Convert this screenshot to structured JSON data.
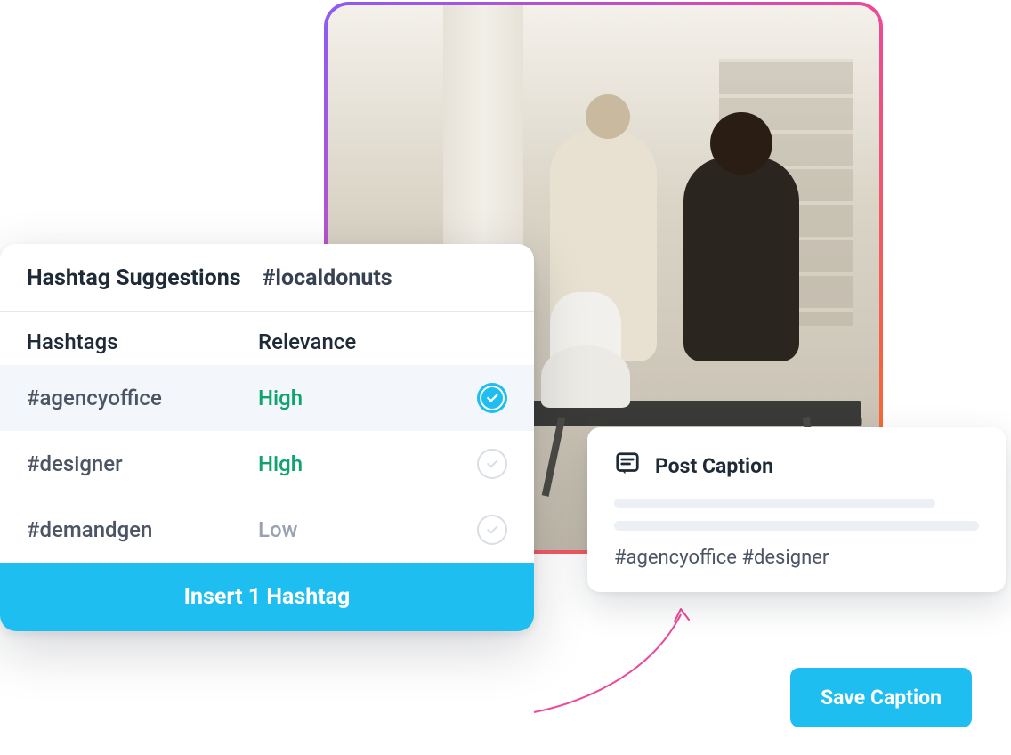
{
  "hashtagPanel": {
    "title": "Hashtag Suggestions",
    "sample": "#localdonuts",
    "columns": {
      "hashtags": "Hashtags",
      "relevance": "Relevance"
    },
    "rows": [
      {
        "tag": "#agencyoffice",
        "relevance": "High",
        "relevanceLevel": "high",
        "selected": true
      },
      {
        "tag": "#designer",
        "relevance": "High",
        "relevanceLevel": "high",
        "selected": false
      },
      {
        "tag": "#demandgen",
        "relevance": "Low",
        "relevanceLevel": "low",
        "selected": false
      }
    ],
    "insertLabel": "Insert 1 Hashtag"
  },
  "captionCard": {
    "title": "Post Caption",
    "captionText": "#agencyoffice #designer"
  },
  "saveButton": {
    "label": "Save Caption"
  },
  "colors": {
    "accent": "#1fbef0",
    "highRelevance": "#10a36e",
    "lowRelevance": "#98a2b3"
  }
}
